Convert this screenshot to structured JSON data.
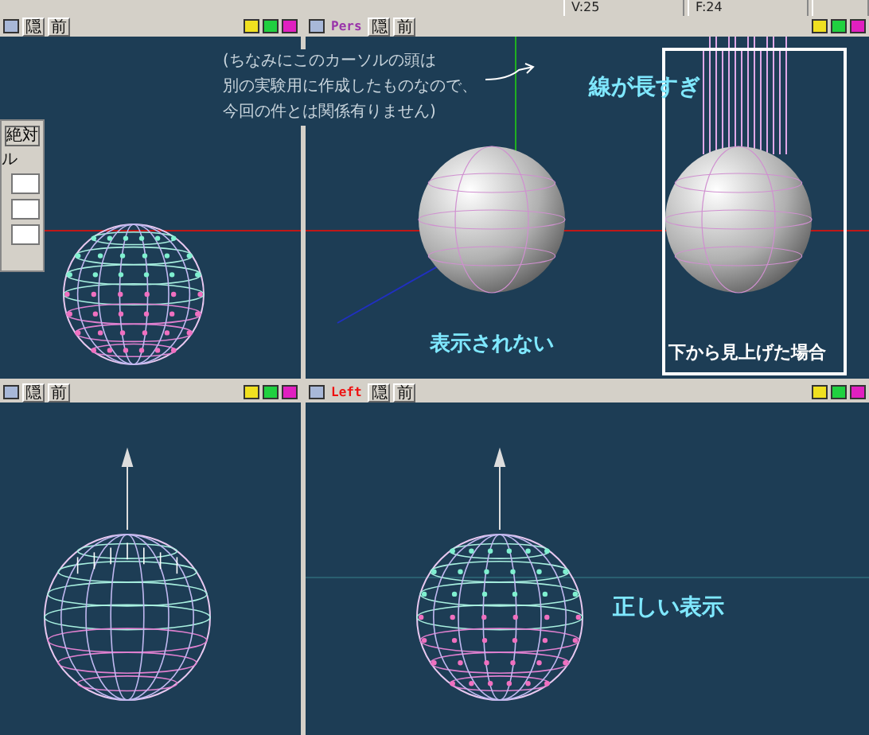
{
  "status_bar": {
    "vertex_count": "V:25",
    "face_count": "F:24"
  },
  "viewports": [
    {
      "kind": "wire-dialog",
      "buttons": [
        "隠",
        "前"
      ],
      "dialog": {
        "button": "絶対",
        "label": "ル"
      }
    },
    {
      "kind": "shaded",
      "label": "Pers",
      "color": "#9933aa",
      "buttons": [
        "隠",
        "前"
      ]
    },
    {
      "kind": "wire-spikes",
      "buttons": [
        "隠",
        "前"
      ]
    },
    {
      "kind": "wire-dots",
      "label": "Left",
      "color": "#ee1111",
      "buttons": [
        "隠",
        "前"
      ]
    }
  ],
  "annotations": [
    {
      "kind": "note",
      "lines": [
        "(ちなみにこのカーソルの頭は",
        "別の実験用に作成したものなので、",
        "今回の件とは関係有りません)"
      ]
    },
    {
      "kind": "headline",
      "text": "線が長すぎ"
    },
    {
      "kind": "caption",
      "text": "表示されない"
    },
    {
      "kind": "frame-caption",
      "text": "下から見上げた場合"
    },
    {
      "kind": "result",
      "text": "正しい表示"
    }
  ]
}
